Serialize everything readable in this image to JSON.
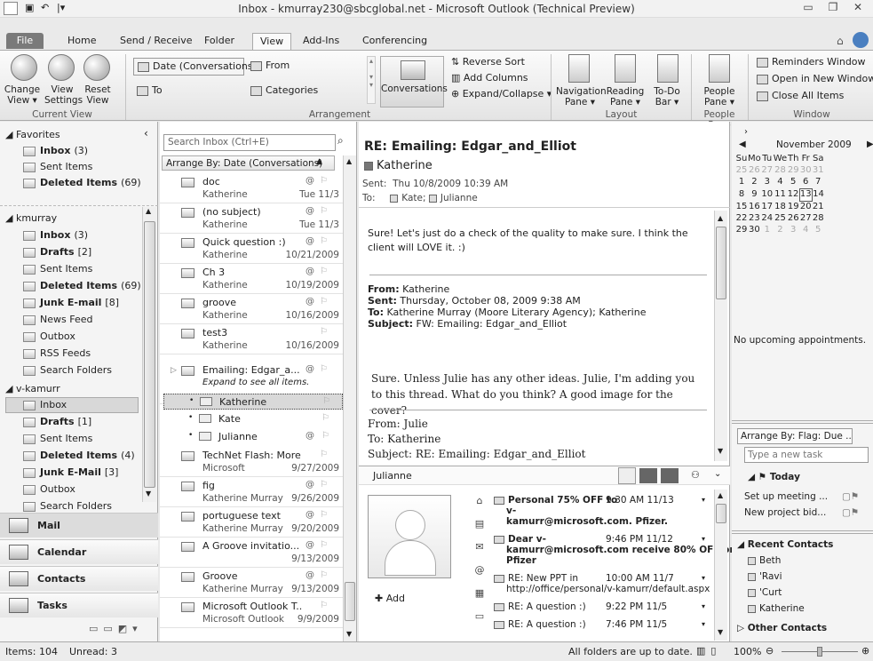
{
  "window": {
    "title": "Inbox - kmurray230@sbcglobal.net - Microsoft Outlook (Technical Preview)"
  },
  "tabs": [
    "File",
    "Home",
    "Send / Receive",
    "Folder",
    "View",
    "Add-Ins",
    "Conferencing"
  ],
  "ribbon": {
    "current_view": {
      "change": "Change View ▾",
      "settings": "View Settings",
      "reset": "Reset View",
      "title": "Current View"
    },
    "arrangement": {
      "date": "Date (Conversations)",
      "from": "From",
      "to": "To",
      "categories": "Categories",
      "conversations": "Conversations",
      "reverse_sort": "Reverse Sort",
      "add_columns": "Add Columns",
      "expand": "Expand/Collapse ▾",
      "title": "Arrangement"
    },
    "layout": {
      "navigation": "Navigation Pane ▾",
      "reading": "Reading Pane ▾",
      "todo": "To-Do Bar ▾",
      "title": "Layout"
    },
    "people_pane": {
      "label": "People Pane ▾",
      "title": "People Pane"
    },
    "window": {
      "reminders": "Reminders Window",
      "open_new": "Open in New Window",
      "close_all": "Close All Items",
      "title": "Window"
    }
  },
  "nav": {
    "favorites": "Favorites",
    "fav_items": [
      {
        "label": "Inbox",
        "count": "(3)",
        "bold": true
      },
      {
        "label": "Sent Items",
        "count": "",
        "bold": false
      },
      {
        "label": "Deleted Items",
        "count": "(69)",
        "bold": true
      }
    ],
    "kmurray": "kmurray",
    "km_items": [
      {
        "label": "Inbox",
        "count": "(3)",
        "bold": true
      },
      {
        "label": "Drafts",
        "count": "[2]",
        "bold": true
      },
      {
        "label": "Sent Items",
        "count": "",
        "bold": false
      },
      {
        "label": "Deleted Items",
        "count": "(69)",
        "bold": true
      },
      {
        "label": "Junk E-mail",
        "count": "[8]",
        "bold": true
      },
      {
        "label": "News Feed",
        "count": "",
        "bold": false
      },
      {
        "label": "Outbox",
        "count": "",
        "bold": false
      },
      {
        "label": "RSS Feeds",
        "count": "",
        "bold": false
      },
      {
        "label": "Search Folders",
        "count": "",
        "bold": false
      }
    ],
    "vkamurr": "v-kamurr",
    "vk_items": [
      {
        "label": "Inbox",
        "count": "",
        "bold": false
      },
      {
        "label": "Drafts",
        "count": "[1]",
        "bold": true
      },
      {
        "label": "Sent Items",
        "count": "",
        "bold": false
      },
      {
        "label": "Deleted Items",
        "count": "(4)",
        "bold": true
      },
      {
        "label": "Junk E-Mail",
        "count": "[3]",
        "bold": true
      },
      {
        "label": "Outbox",
        "count": "",
        "bold": false
      },
      {
        "label": "Search Folders",
        "count": "",
        "bold": false
      }
    ],
    "buttons": [
      "Mail",
      "Calendar",
      "Contacts",
      "Tasks"
    ]
  },
  "list": {
    "search_placeholder": "Search Inbox (Ctrl+E)",
    "arrange": "Arrange By: Date (Conversations)",
    "rows": [
      {
        "subject": "doc",
        "from": "Katherine",
        "date": "Tue 11/3",
        "clip": "@"
      },
      {
        "subject": "(no subject)",
        "from": "Katherine",
        "date": "Tue 11/3",
        "clip": "@"
      },
      {
        "subject": "Quick question :)",
        "from": "Katherine",
        "date": "10/21/2009",
        "clip": "@"
      },
      {
        "subject": "Ch 3",
        "from": "Katherine",
        "date": "10/19/2009",
        "clip": "@"
      },
      {
        "subject": "groove",
        "from": "Katherine",
        "date": "10/16/2009",
        "clip": "@"
      },
      {
        "subject": "test3",
        "from": "Katherine",
        "date": "10/16/2009",
        "clip": ""
      }
    ],
    "conv": {
      "subject": "Emailing: Edgar_a...",
      "hint": "Expand to see all items.",
      "children": [
        "Katherine",
        "Kate",
        "Julianne"
      ]
    },
    "rows2": [
      {
        "subject": "TechNet Flash: More ...",
        "from": "Microsoft",
        "date": "9/27/2009",
        "clip": ""
      },
      {
        "subject": "fig",
        "from": "Katherine Murray",
        "date": "9/26/2009",
        "clip": "@"
      },
      {
        "subject": "portuguese text",
        "from": "Katherine Murray",
        "date": "9/20/2009",
        "clip": "@"
      },
      {
        "subject": "A Groove invitatio...",
        "from": "",
        "date": "9/13/2009",
        "clip": "@"
      },
      {
        "subject": "Groove",
        "from": "Katherine Murray",
        "date": "9/13/2009",
        "clip": "@"
      },
      {
        "subject": "Microsoft Outlook T...",
        "from": "Microsoft Outlook",
        "date": "9/9/2009",
        "clip": ""
      }
    ]
  },
  "reading": {
    "subject": "RE: Emailing: Edgar_and_Elliot",
    "sender": "Katherine",
    "sent_label": "Sent:",
    "sent": "Thu 10/8/2009 10:39 AM",
    "to_label": "To:",
    "to": [
      "Kate",
      "Julianne"
    ],
    "body1": "Sure! Let's just do a check of the quality to make sure. I think the client will LOVE it. :)",
    "fwd": {
      "from_l": "From:",
      "from": "Katherine",
      "sent_l": "Sent:",
      "sent": "Thursday, October 08, 2009 9:38 AM",
      "to_l": "To:",
      "to": "Katherine Murray (Moore Literary Agency); Katherine",
      "subj_l": "Subject:",
      "subj": "FW: Emailing: Edgar_and_Elliot"
    },
    "body2": "Sure. Unless Julie has any other ideas. Julie, I'm adding you to this thread. What do you think? A good image for the cover?",
    "fwd2": {
      "from": "From: Julie",
      "to": "To: Katherine",
      "subj": "Subject: RE: Emailing: Edgar_and_Elliot"
    }
  },
  "people": {
    "name": "Julianne",
    "add": "Add",
    "items": [
      {
        "l1": "Personal 75% OFF to",
        "time": "9:30 AM 11/13",
        "l2": "v-",
        "l3": "kamurr@microsoft.com. Pfizer.",
        "bold": true
      },
      {
        "l1": "Dear v-",
        "time": "9:46 PM 11/12",
        "l2": "kamurr@microsoft.com receive 80% OFF on",
        "l3": "Pfizer",
        "bold": true
      },
      {
        "l1": "RE: New PPT in",
        "time": "10:00 AM 11/7",
        "l2": "http://office/personal/v-kamurr/default.aspx",
        "l3": "",
        "bold": false
      },
      {
        "l1": "RE: A question :)",
        "time": "9:22 PM 11/5",
        "l2": "",
        "l3": "",
        "bold": false
      },
      {
        "l1": "RE: A question :)",
        "time": "7:46 PM 11/5",
        "l2": "",
        "l3": "",
        "bold": false
      }
    ]
  },
  "todo": {
    "month": "November 2009",
    "days": [
      "Su",
      "Mo",
      "Tu",
      "We",
      "Th",
      "Fr",
      "Sa"
    ],
    "weeks": [
      [
        "25",
        "26",
        "27",
        "28",
        "29",
        "30",
        "31"
      ],
      [
        "1",
        "2",
        "3",
        "4",
        "5",
        "6",
        "7"
      ],
      [
        "8",
        "9",
        "10",
        "11",
        "12",
        "13",
        "14"
      ],
      [
        "15",
        "16",
        "17",
        "18",
        "19",
        "20",
        "21"
      ],
      [
        "22",
        "23",
        "24",
        "25",
        "26",
        "27",
        "28"
      ],
      [
        "29",
        "30",
        "1",
        "2",
        "3",
        "4",
        "5"
      ]
    ],
    "today": "13",
    "no_appts": "No upcoming appointments.",
    "arrange": "Arrange By: Flag: Due ...",
    "new_task": "Type a new task",
    "today_label": "Today",
    "tasks": [
      "Set up meeting ...",
      "New project bid..."
    ],
    "recent": "Recent Contacts",
    "contacts": [
      "Beth",
      "'Ravi",
      "'Curt",
      "Katherine"
    ],
    "other": "Other Contacts"
  },
  "status": {
    "items": "Items: 104",
    "unread": "Unread: 3",
    "sync": "All folders are up to date.",
    "zoom": "100%"
  }
}
